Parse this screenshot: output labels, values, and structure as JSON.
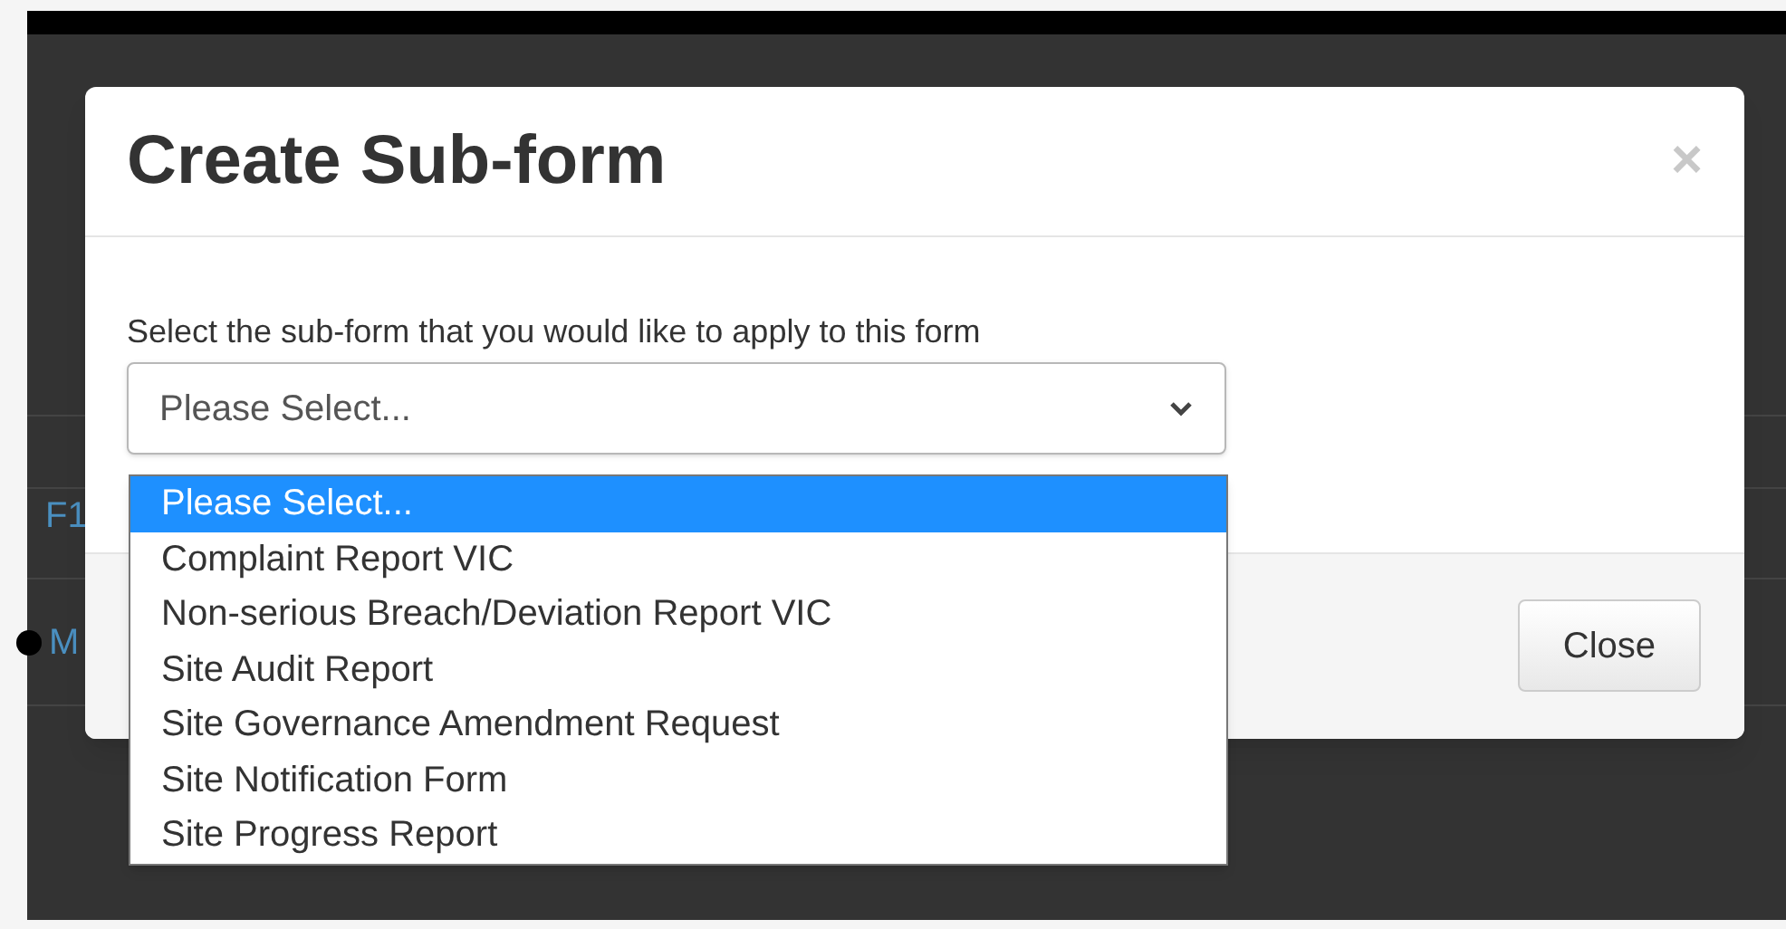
{
  "background": {
    "link_text": "F1",
    "button_text": "M"
  },
  "dialog": {
    "title": "Create Sub-form",
    "close_symbol": "×",
    "label": "Select the sub-form that you would like to apply to this form",
    "select": {
      "value": "Please Select...",
      "expanded": true,
      "options": [
        {
          "label": "Please Select...",
          "selected": true
        },
        {
          "label": "Complaint Report VIC",
          "selected": false
        },
        {
          "label": "Non-serious Breach/Deviation Report VIC",
          "selected": false
        },
        {
          "label": "Site Audit Report",
          "selected": false
        },
        {
          "label": "Site Governance Amendment Request",
          "selected": false
        },
        {
          "label": "Site Notification Form",
          "selected": false
        },
        {
          "label": "Site Progress Report",
          "selected": false
        }
      ]
    },
    "buttons": [
      "Close"
    ]
  }
}
